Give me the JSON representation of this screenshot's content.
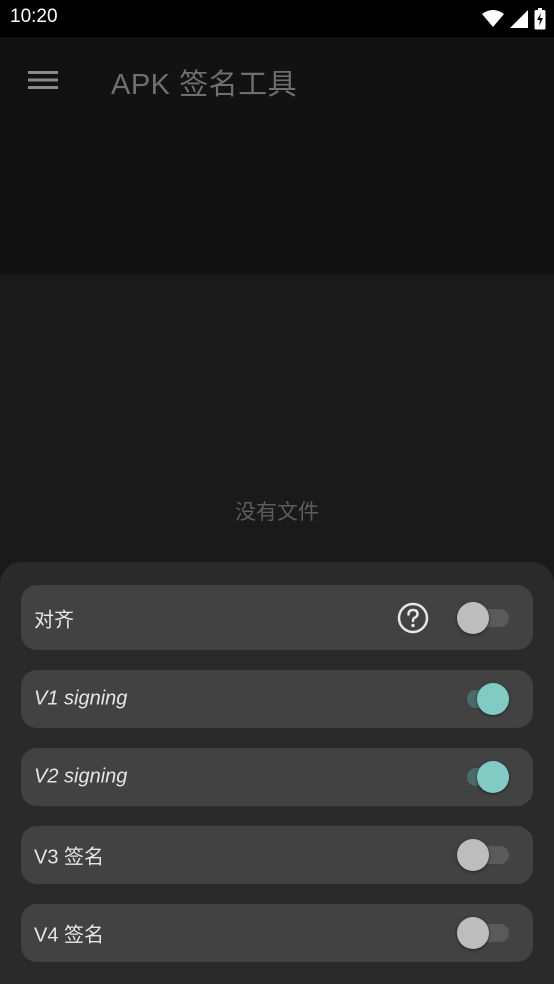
{
  "status_bar": {
    "time": "10:20",
    "icons": [
      "wifi-icon",
      "signal-icon",
      "battery-charging-icon"
    ]
  },
  "app_bar": {
    "title": "APK 签名工具",
    "menu_icon": "hamburger-menu-icon"
  },
  "content": {
    "empty_text": "没有文件"
  },
  "options": [
    {
      "label": "对齐",
      "italic": false,
      "checked": false,
      "has_help": true
    },
    {
      "label": "V1 signing",
      "italic": true,
      "checked": true,
      "has_help": false
    },
    {
      "label": "V2 signing",
      "italic": true,
      "checked": true,
      "has_help": false
    },
    {
      "label": "V3 签名",
      "italic": false,
      "checked": false,
      "has_help": false
    },
    {
      "label": "V4 签名",
      "italic": false,
      "checked": false,
      "has_help": false
    }
  ],
  "colors": {
    "accent": "#80cbc4",
    "sheet_bg": "#2a2a2a",
    "option_bg": "#424242"
  }
}
